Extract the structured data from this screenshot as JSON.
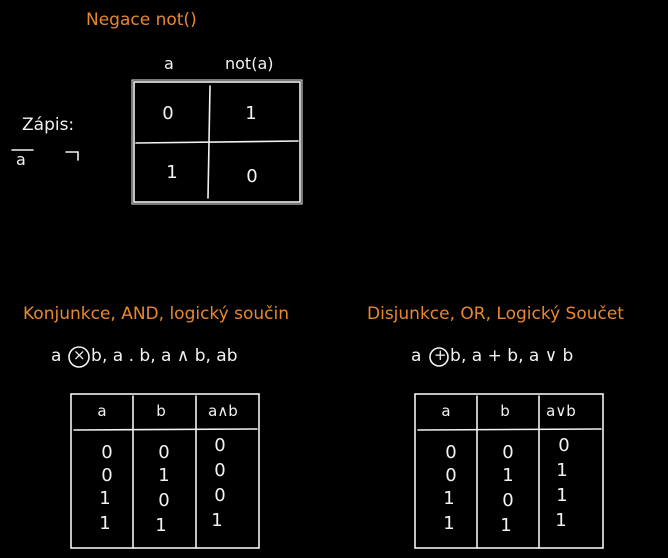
{
  "negation": {
    "title": "Negace not()",
    "header_a": "a",
    "header_not": "not(a)",
    "rows": [
      [
        "0",
        "1"
      ],
      [
        "1",
        "0"
      ]
    ],
    "notation_label": "Zápis:",
    "notation_bar": "a",
    "notation_neg": "¬a"
  },
  "conjunction": {
    "title": "Konjunkce, AND, logický součin",
    "notation": ", a . b, a ∧ b, ab",
    "notation_a": "a",
    "operator_symbol": "×",
    "notation_b": "b",
    "headers": [
      "a",
      "b",
      "a∧b"
    ],
    "rows": [
      [
        "0",
        "0",
        "0"
      ],
      [
        "0",
        "1",
        "0"
      ],
      [
        "1",
        "0",
        "0"
      ],
      [
        "1",
        "1",
        "1"
      ]
    ]
  },
  "disjunction": {
    "title": "Disjunkce, OR, Logický Součet",
    "notation": ", a + b, a ∨ b",
    "notation_a": "a",
    "operator_symbol": "+",
    "notation_b": "b",
    "headers": [
      "a",
      "b",
      "a∨b"
    ],
    "rows": [
      [
        "0",
        "0",
        "0"
      ],
      [
        "0",
        "1",
        "1"
      ],
      [
        "1",
        "0",
        "1"
      ],
      [
        "1",
        "1",
        "1"
      ]
    ]
  },
  "colors": {
    "accent": "#e9872c",
    "line": "#f2f2f2",
    "background": "#000000"
  }
}
